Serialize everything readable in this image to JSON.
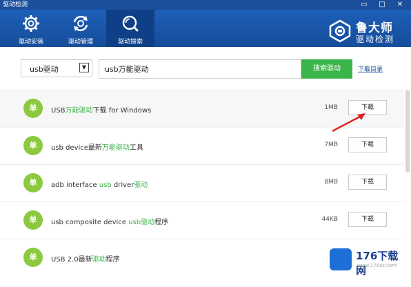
{
  "window": {
    "title": "驱动检测",
    "min": "▭",
    "max": "□",
    "close": "✕"
  },
  "nav": [
    {
      "label": "驱动安装",
      "icon": "gear-icon"
    },
    {
      "label": "驱动管理",
      "icon": "refresh-gear-icon"
    },
    {
      "label": "驱动搜索",
      "icon": "search-icon"
    }
  ],
  "brand": {
    "title": "鲁大师",
    "subtitle": "驱动检测"
  },
  "search": {
    "category": "usb驱动",
    "query": "usb万能驱动",
    "button": "搜索驱动",
    "download_dir": "下载目录"
  },
  "results": [
    {
      "badge": "单",
      "pre": "USB",
      "kw": "万能驱动",
      "post": "下载 for Windows",
      "size": "1MB",
      "action": "下载"
    },
    {
      "badge": "单",
      "pre": "usb device最新",
      "kw": "万能驱动",
      "post": "工具",
      "size": "7MB",
      "action": "下载"
    },
    {
      "badge": "单",
      "pre": "adb interface ",
      "kw": "usb",
      "post": " driver",
      "kw2": "驱动",
      "size": "8MB",
      "action": "下载"
    },
    {
      "badge": "单",
      "pre": "usb composite device ",
      "kw": "usb驱动",
      "post": "程序",
      "size": "44KB",
      "action": "下载"
    },
    {
      "badge": "单",
      "pre": "USB 2.0最新",
      "kw": "驱动",
      "post": "程序",
      "size": "",
      "action": ""
    }
  ],
  "watermark": {
    "text": "176下载网",
    "sub": "www.176xz.com"
  },
  "colors": {
    "header": "#1d5fb8",
    "accent_green": "#3bb549",
    "badge_green": "#8bc93e"
  }
}
